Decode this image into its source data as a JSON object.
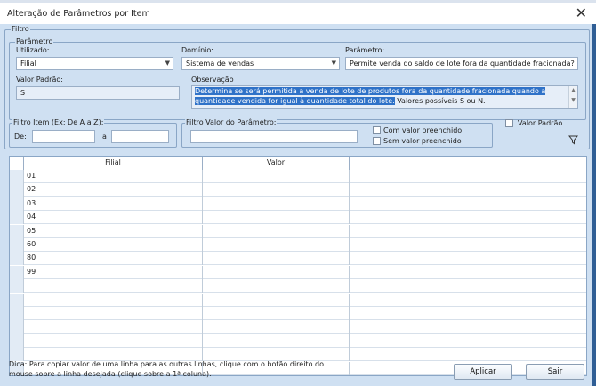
{
  "window": {
    "title": "Alteração de Parâmetros por Item",
    "close_glyph": "✕"
  },
  "filtro": {
    "legend": "Filtro",
    "parametro_group": {
      "legend": "Parâmetro",
      "utilizado": {
        "label": "Utilizado:",
        "value": "Filial"
      },
      "dominio": {
        "label": "Domínio:",
        "value": "Sistema de vendas"
      },
      "parametro": {
        "label": "Parâmetro:",
        "value": "Permite venda do saldo de lote fora da quantidade fracionada?"
      },
      "valor_padrao": {
        "label": "Valor Padrão:",
        "value": "S"
      },
      "observacao": {
        "label": "Observação",
        "highlighted": "Determina se será permitida a venda de lote de produtos fora da quantidade fracionada quando a quantidade vendida for igual à quantidade total do lote.",
        "rest": " Valores possíveis S ou N."
      }
    },
    "filtro_item": {
      "legend": "Filtro Item (Ex: De A a Z):",
      "de_label": "De:",
      "a_label": "a",
      "de_value": "",
      "a_value": ""
    },
    "filtro_valor": {
      "legend": "Filtro Valor do Parâmetro:",
      "value": "",
      "com_valor": "Com valor preenchido",
      "sem_valor": "Sem valor preenchido"
    },
    "valor_padrao_check": "Valor Padrão",
    "filter_icon": "funnel-icon"
  },
  "grid": {
    "columns": [
      "Filial",
      "Valor"
    ],
    "rows": [
      {
        "filial": "01",
        "valor": ""
      },
      {
        "filial": "02",
        "valor": ""
      },
      {
        "filial": "03",
        "valor": ""
      },
      {
        "filial": "04",
        "valor": ""
      },
      {
        "filial": "05",
        "valor": ""
      },
      {
        "filial": "60",
        "valor": ""
      },
      {
        "filial": "80",
        "valor": ""
      },
      {
        "filial": "99",
        "valor": ""
      }
    ]
  },
  "footer": {
    "hint": "Dica: Para copiar valor de uma linha para as outras linhas, clique com o botão direito do mouse sobre a linha desejada (clique sobre a 1ª coluna).",
    "apply": "Aplicar",
    "exit": "Sair"
  },
  "colors": {
    "panel": "#cfe0f2",
    "highlight": "#2f72c8",
    "border": "#8aa6c6"
  }
}
